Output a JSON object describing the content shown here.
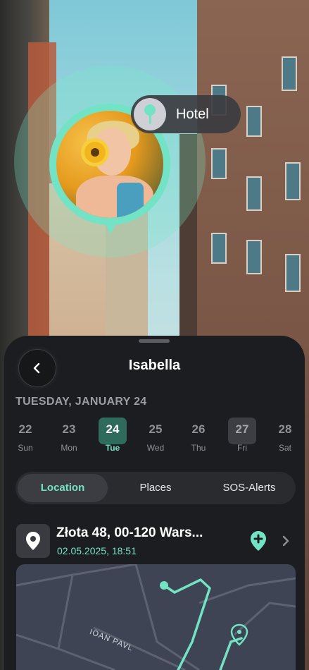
{
  "place_tag": {
    "label": "Hotel",
    "icon": "location-pin-icon"
  },
  "header": {
    "title": "Isabella",
    "back_icon": "chevron-left-icon"
  },
  "date_label": "TUESDAY, JANUARY 24",
  "days": [
    {
      "num": "22",
      "weekday": "Sun"
    },
    {
      "num": "23",
      "weekday": "Mon"
    },
    {
      "num": "24",
      "weekday": "Tue",
      "selected": true
    },
    {
      "num": "25",
      "weekday": "Wed"
    },
    {
      "num": "26",
      "weekday": "Thu"
    },
    {
      "num": "27",
      "weekday": "Fri",
      "highlighted": true
    },
    {
      "num": "28",
      "weekday": "Sat"
    }
  ],
  "tabs": [
    {
      "label": "Location",
      "active": true
    },
    {
      "label": "Places"
    },
    {
      "label": "SOS-Alerts"
    }
  ],
  "location": {
    "address": "Złota 48, 00-120 Wars...",
    "timestamp": "02.05.2025, 18:51",
    "icon": "location-pin-icon",
    "add_icon": "add-location-icon",
    "chevron_icon": "chevron-right-icon"
  },
  "map": {
    "street_label": "IOAN PAVL"
  },
  "colors": {
    "accent": "#73e3c6",
    "sheet": "#1c1d20",
    "selected_day": "#2f6b5c"
  }
}
